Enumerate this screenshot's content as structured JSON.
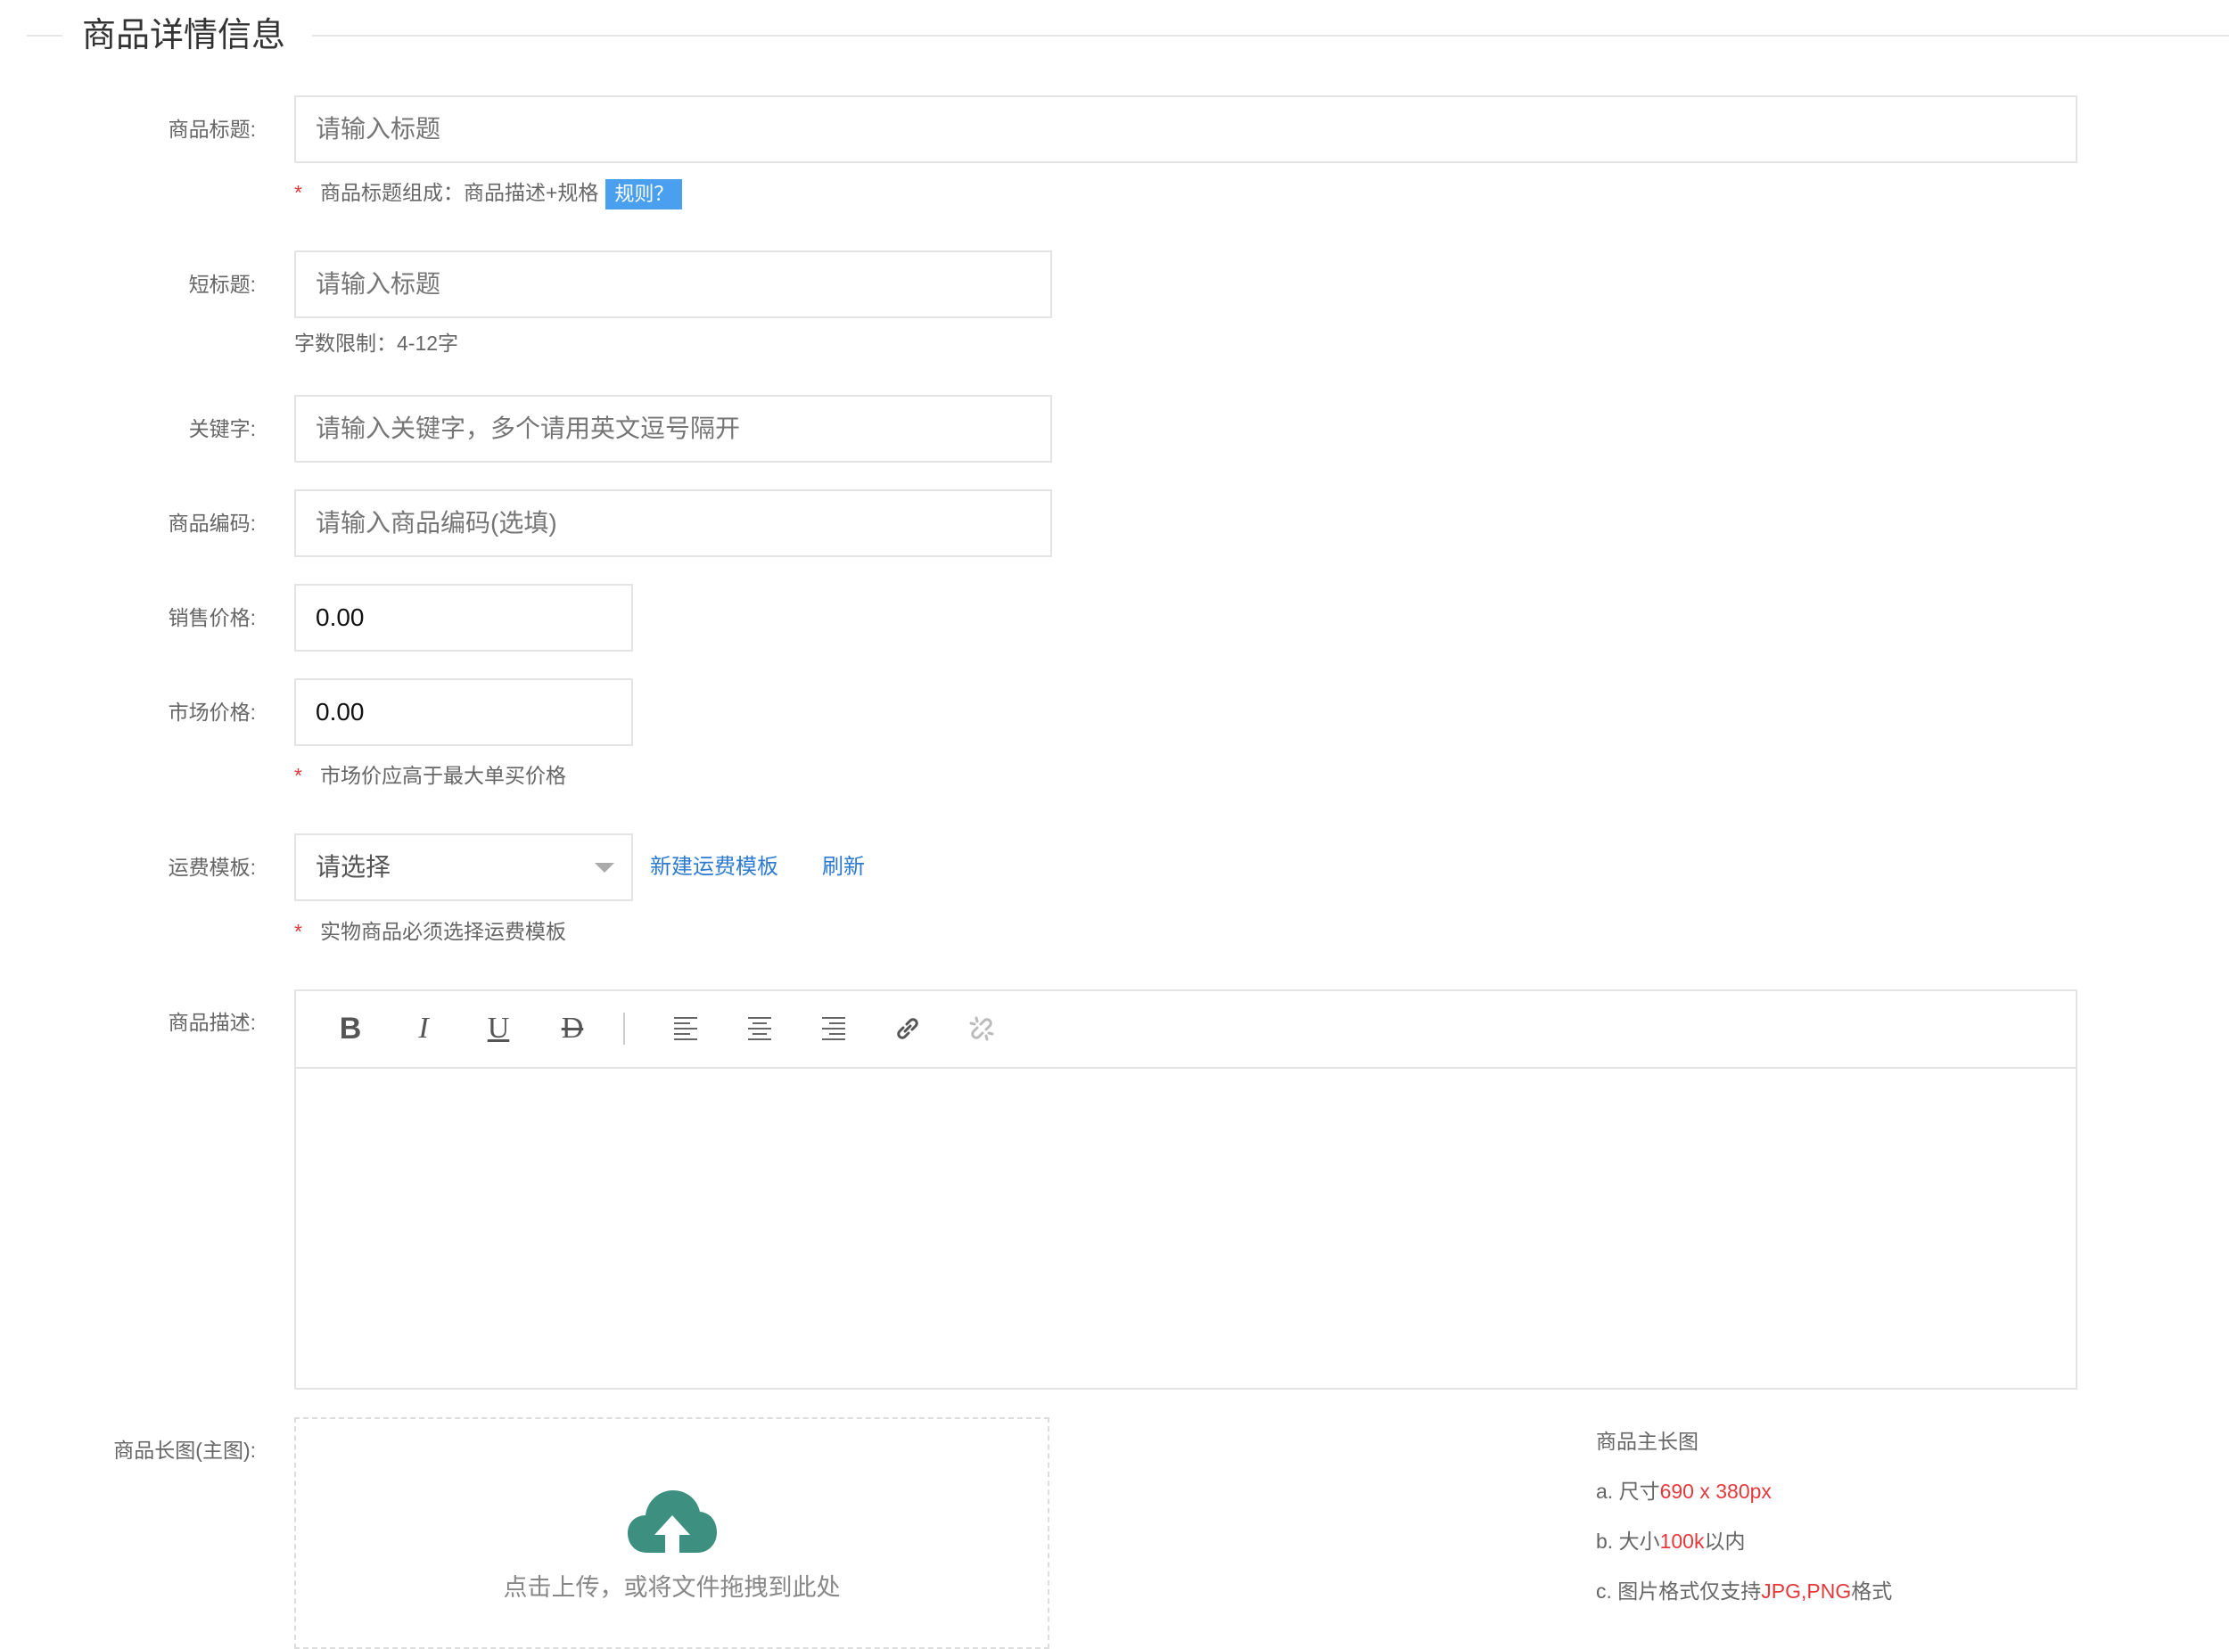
{
  "section_title": "商品详情信息",
  "fields": {
    "title": {
      "label": "商品标题:",
      "placeholder": "请输入标题"
    },
    "title_hint": {
      "text": "商品标题组成：商品描述+规格",
      "rule_button": "规则？"
    },
    "short_title": {
      "label": "短标题:",
      "placeholder": "请输入标题"
    },
    "short_title_hint": "字数限制：4-12字",
    "keywords": {
      "label": "关键字:",
      "placeholder": "请输入关键字，多个请用英文逗号隔开"
    },
    "code": {
      "label": "商品编码:",
      "placeholder": "请输入商品编码(选填)"
    },
    "sale_price": {
      "label": "销售价格:",
      "value": "0.00"
    },
    "market_price": {
      "label": "市场价格:",
      "value": "0.00"
    },
    "market_price_hint": "市场价应高于最大单买价格",
    "shipping": {
      "label": "运费模板:",
      "selected": "请选择",
      "new_link": "新建运费模板",
      "refresh_link": "刷新"
    },
    "shipping_hint": "实物商品必须选择运费模板",
    "description": {
      "label": "商品描述:"
    },
    "long_image": {
      "label": "商品长图(主图):",
      "upload_text": "点击上传，或将文件拖拽到此处"
    }
  },
  "tips": {
    "title": "商品主长图",
    "a_prefix": "a. 尺寸",
    "a_value": "690 x 380px",
    "b_prefix": "b. 大小",
    "b_value": "100k",
    "b_suffix": "以内",
    "c_prefix": "c. 图片格式仅支持",
    "c_value": "JPG,PNG",
    "c_suffix": "格式"
  },
  "colors": {
    "accent_link": "#2d7bd1",
    "required_star": "#e4393c",
    "rule_button": "#4a9fef",
    "upload_icon": "#3d8f7f"
  },
  "editor_toolbar": [
    "bold-icon",
    "italic-icon",
    "underline-icon",
    "strikethrough-icon",
    "align-left-icon",
    "align-center-icon",
    "align-right-icon",
    "link-icon",
    "unlink-icon"
  ]
}
